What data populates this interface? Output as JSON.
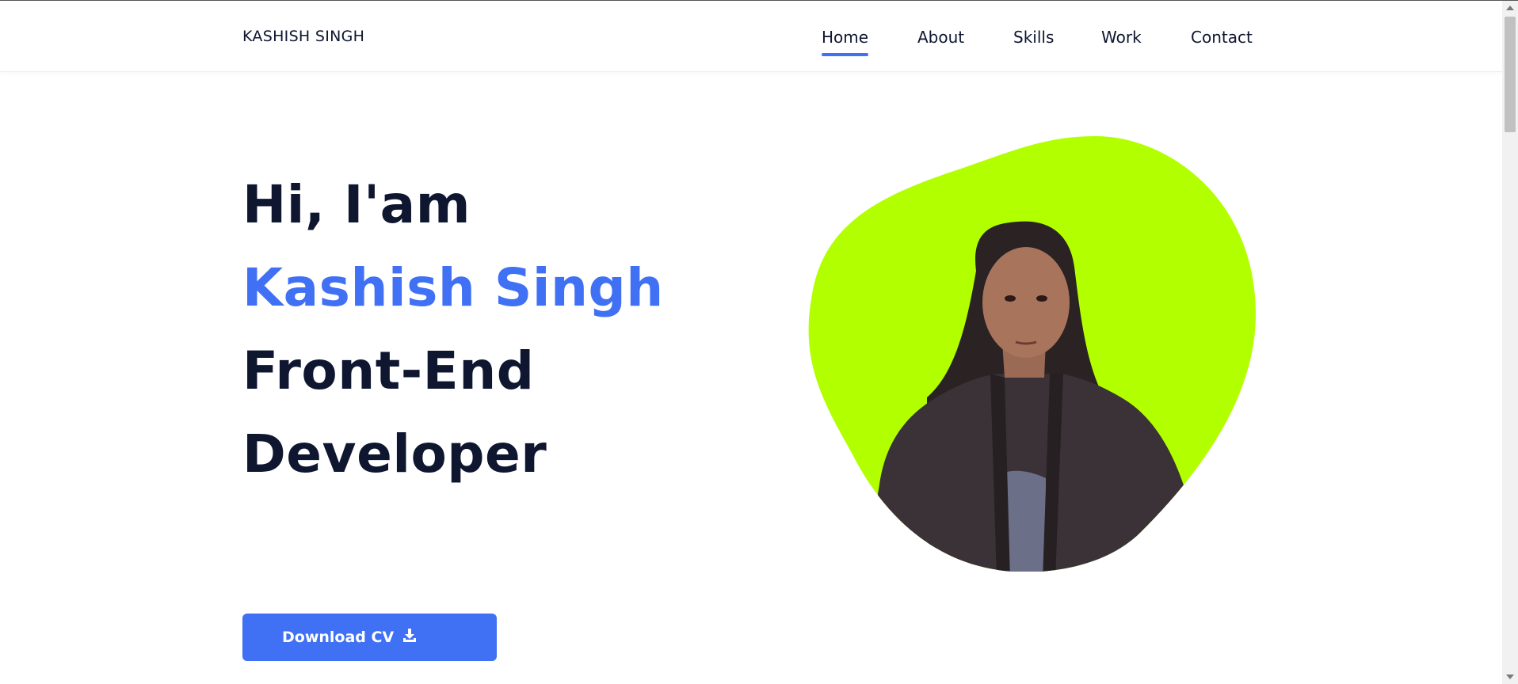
{
  "header": {
    "logo": "KASHISH SINGH",
    "nav": [
      {
        "label": "Home",
        "active": true
      },
      {
        "label": "About",
        "active": false
      },
      {
        "label": "Skills",
        "active": false
      },
      {
        "label": "Work",
        "active": false
      },
      {
        "label": "Contact",
        "active": false
      }
    ]
  },
  "hero": {
    "greeting": "Hi, I'am",
    "name": "Kashish Singh",
    "role_line1": "Front-End",
    "role_line2": "Developer",
    "cta_label": "Download CV",
    "cta_icon": "download-icon"
  },
  "image": {
    "description_icon": "profile-photo",
    "blob_color": "#b2ff00"
  },
  "colors": {
    "accent": "#4070f4",
    "text": "#0e1630"
  }
}
